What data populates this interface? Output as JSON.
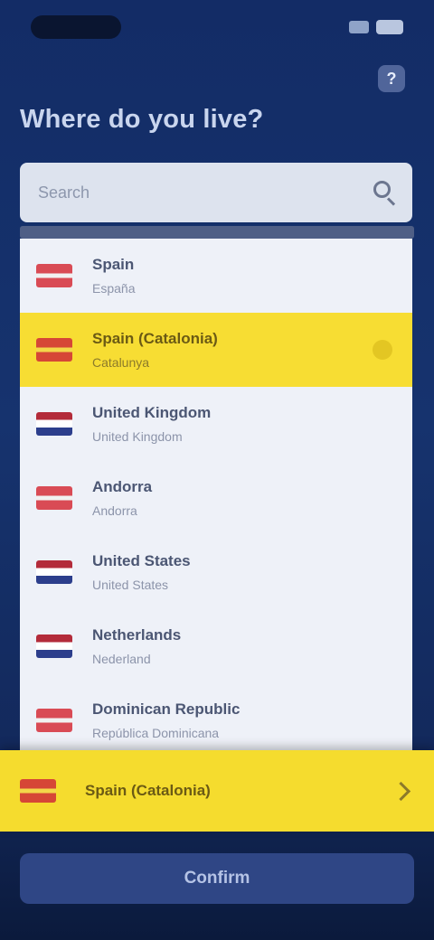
{
  "header": {
    "title": "Where do you live?",
    "help_label": "?"
  },
  "search": {
    "value": "",
    "placeholder": "Search"
  },
  "countries": [
    {
      "name": "Spain",
      "subtitle": "España",
      "flag_icon": "flag-icon",
      "selected": false
    },
    {
      "name": "Spain (Catalonia)",
      "subtitle": "Catalunya",
      "flag_icon": "flag-icon",
      "selected": true
    },
    {
      "name": "United Kingdom",
      "subtitle": "United Kingdom",
      "flag_icon": "flag-icon",
      "selected": false
    },
    {
      "name": "Andorra",
      "subtitle": "Andorra",
      "flag_icon": "flag-icon",
      "selected": false
    },
    {
      "name": "United States",
      "subtitle": "United States",
      "flag_icon": "flag-icon",
      "selected": false
    },
    {
      "name": "Netherlands",
      "subtitle": "Nederland",
      "flag_icon": "flag-icon",
      "selected": false
    },
    {
      "name": "Dominican Republic",
      "subtitle": "República Dominicana",
      "flag_icon": "flag-icon",
      "selected": false
    }
  ],
  "banner": {
    "text": "Spain (Catalonia)"
  },
  "footer": {
    "confirm_label": "Confirm"
  },
  "colors": {
    "background": "#132c66",
    "accent": "#f5dc2e",
    "button": "#2f4685"
  }
}
